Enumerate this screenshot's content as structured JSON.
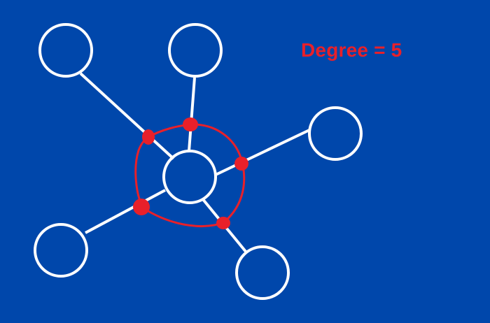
{
  "annotation": {
    "label": "Degree = 5"
  },
  "graph": {
    "center_node": "center",
    "neighbors": [
      "top-left",
      "top",
      "right",
      "bottom-right",
      "bottom-left"
    ],
    "edge_count": 5,
    "degree": 5
  },
  "colors": {
    "background": "#0047AB",
    "lines": "#FFFFFF",
    "highlight": "#E8202A"
  }
}
